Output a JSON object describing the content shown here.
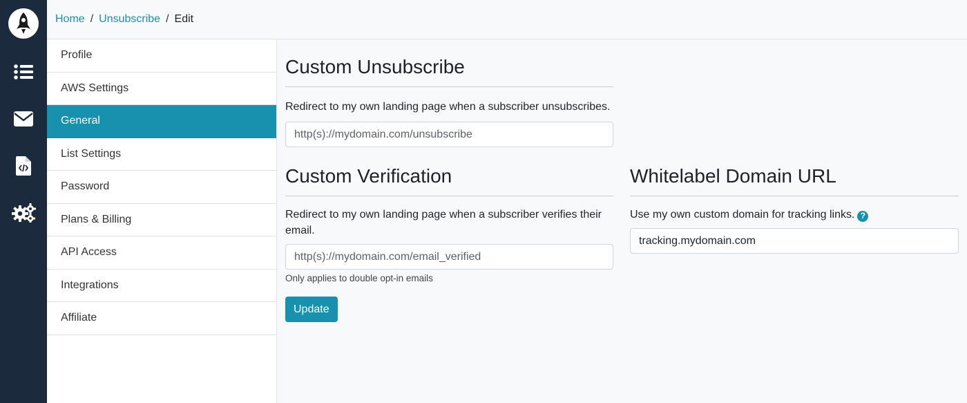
{
  "breadcrumb": {
    "home": "Home",
    "section": "Unsubscribe",
    "current": "Edit"
  },
  "rail": {
    "icons": [
      "rocket-logo-icon",
      "list-icon",
      "envelope-icon",
      "code-file-icon",
      "gears-icon"
    ],
    "background": "#1b2a3d"
  },
  "sidebar": {
    "items": [
      {
        "label": "Profile"
      },
      {
        "label": "AWS Settings"
      },
      {
        "label": "General",
        "active": true
      },
      {
        "label": "List Settings"
      },
      {
        "label": "Password"
      },
      {
        "label": "Plans & Billing"
      },
      {
        "label": "API Access"
      },
      {
        "label": "Integrations"
      },
      {
        "label": "Affiliate"
      }
    ]
  },
  "unsubscribe": {
    "title": "Custom Unsubscribe",
    "description": "Redirect to my own landing page when a subscriber unsubscribes.",
    "placeholder": "http(s)://mydomain.com/unsubscribe"
  },
  "verification": {
    "title": "Custom Verification",
    "description": "Redirect to my own landing page when a subscriber verifies their email.",
    "placeholder": "http(s)://mydomain.com/email_verified",
    "hint": "Only applies to double opt-in emails",
    "button": "Update"
  },
  "whitelabel": {
    "title": "Whitelabel Domain URL",
    "description": "Use my own custom domain for tracking links.",
    "help_icon": "?",
    "value": "tracking.mydomain.com"
  },
  "colors": {
    "accent": "#1791ad",
    "link": "#1a8fb0"
  }
}
